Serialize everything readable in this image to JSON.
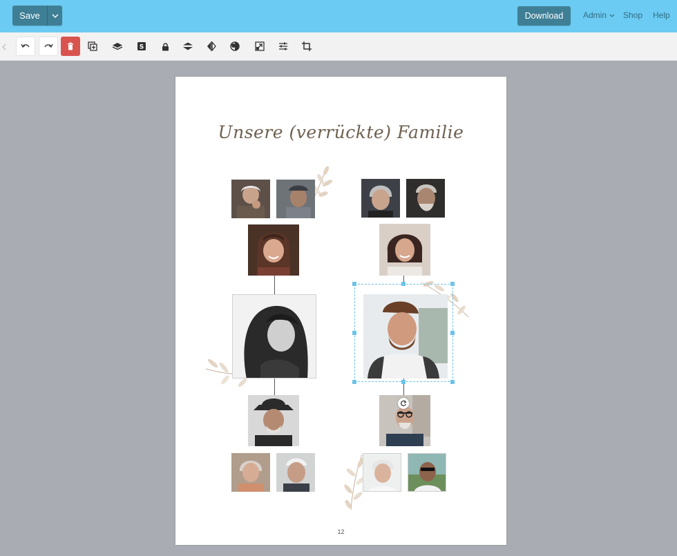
{
  "topbar": {
    "save_label": "Save",
    "download_label": "Download",
    "nav": [
      "Admin",
      "Shop",
      "Help"
    ]
  },
  "toolbar": {
    "tools": [
      "undo-icon",
      "redo-icon",
      "trash-icon",
      "duplicate-icon",
      "layers-icon",
      "sticker-icon",
      "lock-icon",
      "arrange-icon",
      "flip-icon",
      "opacity-icon",
      "replace-icon",
      "adjust-icon",
      "crop-icon"
    ]
  },
  "page": {
    "title": "Unsere (verrückte) Familie",
    "page_number": "12"
  },
  "colors": {
    "topbar": "#6ccbf2",
    "button": "#3f7f96",
    "delete": "#d9534f",
    "selection": "#6cc3e8",
    "canvas_bg": "#a9adb3"
  }
}
